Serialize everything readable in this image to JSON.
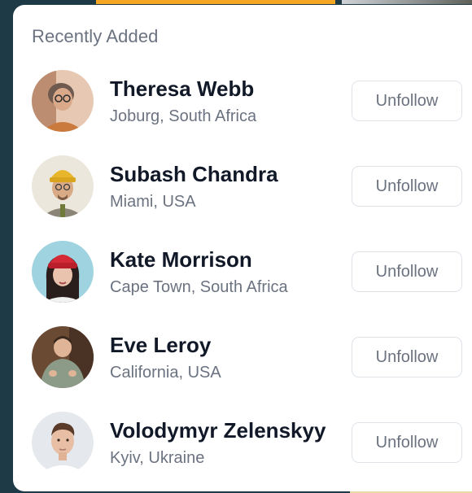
{
  "card": {
    "title": "Recently Added"
  },
  "users": [
    {
      "name": "Theresa Webb",
      "location": "Joburg, South Africa",
      "action_label": "Unfollow"
    },
    {
      "name": "Subash Chandra",
      "location": "Miami, USA",
      "action_label": "Unfollow"
    },
    {
      "name": "Kate Morrison",
      "location": "Cape Town, South Africa",
      "action_label": "Unfollow"
    },
    {
      "name": "Eve Leroy",
      "location": "California, USA",
      "action_label": "Unfollow"
    },
    {
      "name": "Volodymyr Zelenskyy",
      "location": "Kyiv, Ukraine",
      "action_label": "Unfollow"
    }
  ],
  "colors": {
    "page_background": "#1f3a47",
    "accent_strip": "#f5a623",
    "card_background": "#ffffff",
    "name_text": "#111827",
    "secondary_text": "#6b7280",
    "button_border": "#dfe3e8"
  }
}
